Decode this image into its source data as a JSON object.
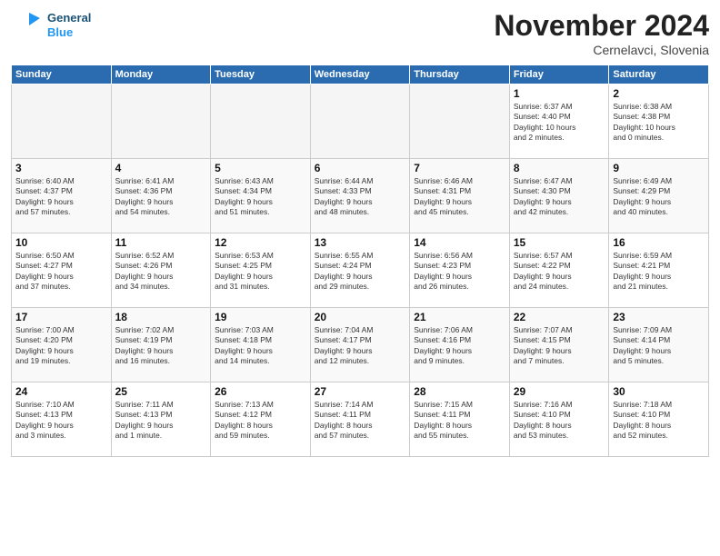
{
  "logo": {
    "line1": "General",
    "line2": "Blue"
  },
  "title": "November 2024",
  "location": "Cernelavci, Slovenia",
  "weekdays": [
    "Sunday",
    "Monday",
    "Tuesday",
    "Wednesday",
    "Thursday",
    "Friday",
    "Saturday"
  ],
  "weeks": [
    [
      {
        "day": "",
        "info": ""
      },
      {
        "day": "",
        "info": ""
      },
      {
        "day": "",
        "info": ""
      },
      {
        "day": "",
        "info": ""
      },
      {
        "day": "",
        "info": ""
      },
      {
        "day": "1",
        "info": "Sunrise: 6:37 AM\nSunset: 4:40 PM\nDaylight: 10 hours\nand 2 minutes."
      },
      {
        "day": "2",
        "info": "Sunrise: 6:38 AM\nSunset: 4:38 PM\nDaylight: 10 hours\nand 0 minutes."
      }
    ],
    [
      {
        "day": "3",
        "info": "Sunrise: 6:40 AM\nSunset: 4:37 PM\nDaylight: 9 hours\nand 57 minutes."
      },
      {
        "day": "4",
        "info": "Sunrise: 6:41 AM\nSunset: 4:36 PM\nDaylight: 9 hours\nand 54 minutes."
      },
      {
        "day": "5",
        "info": "Sunrise: 6:43 AM\nSunset: 4:34 PM\nDaylight: 9 hours\nand 51 minutes."
      },
      {
        "day": "6",
        "info": "Sunrise: 6:44 AM\nSunset: 4:33 PM\nDaylight: 9 hours\nand 48 minutes."
      },
      {
        "day": "7",
        "info": "Sunrise: 6:46 AM\nSunset: 4:31 PM\nDaylight: 9 hours\nand 45 minutes."
      },
      {
        "day": "8",
        "info": "Sunrise: 6:47 AM\nSunset: 4:30 PM\nDaylight: 9 hours\nand 42 minutes."
      },
      {
        "day": "9",
        "info": "Sunrise: 6:49 AM\nSunset: 4:29 PM\nDaylight: 9 hours\nand 40 minutes."
      }
    ],
    [
      {
        "day": "10",
        "info": "Sunrise: 6:50 AM\nSunset: 4:27 PM\nDaylight: 9 hours\nand 37 minutes."
      },
      {
        "day": "11",
        "info": "Sunrise: 6:52 AM\nSunset: 4:26 PM\nDaylight: 9 hours\nand 34 minutes."
      },
      {
        "day": "12",
        "info": "Sunrise: 6:53 AM\nSunset: 4:25 PM\nDaylight: 9 hours\nand 31 minutes."
      },
      {
        "day": "13",
        "info": "Sunrise: 6:55 AM\nSunset: 4:24 PM\nDaylight: 9 hours\nand 29 minutes."
      },
      {
        "day": "14",
        "info": "Sunrise: 6:56 AM\nSunset: 4:23 PM\nDaylight: 9 hours\nand 26 minutes."
      },
      {
        "day": "15",
        "info": "Sunrise: 6:57 AM\nSunset: 4:22 PM\nDaylight: 9 hours\nand 24 minutes."
      },
      {
        "day": "16",
        "info": "Sunrise: 6:59 AM\nSunset: 4:21 PM\nDaylight: 9 hours\nand 21 minutes."
      }
    ],
    [
      {
        "day": "17",
        "info": "Sunrise: 7:00 AM\nSunset: 4:20 PM\nDaylight: 9 hours\nand 19 minutes."
      },
      {
        "day": "18",
        "info": "Sunrise: 7:02 AM\nSunset: 4:19 PM\nDaylight: 9 hours\nand 16 minutes."
      },
      {
        "day": "19",
        "info": "Sunrise: 7:03 AM\nSunset: 4:18 PM\nDaylight: 9 hours\nand 14 minutes."
      },
      {
        "day": "20",
        "info": "Sunrise: 7:04 AM\nSunset: 4:17 PM\nDaylight: 9 hours\nand 12 minutes."
      },
      {
        "day": "21",
        "info": "Sunrise: 7:06 AM\nSunset: 4:16 PM\nDaylight: 9 hours\nand 9 minutes."
      },
      {
        "day": "22",
        "info": "Sunrise: 7:07 AM\nSunset: 4:15 PM\nDaylight: 9 hours\nand 7 minutes."
      },
      {
        "day": "23",
        "info": "Sunrise: 7:09 AM\nSunset: 4:14 PM\nDaylight: 9 hours\nand 5 minutes."
      }
    ],
    [
      {
        "day": "24",
        "info": "Sunrise: 7:10 AM\nSunset: 4:13 PM\nDaylight: 9 hours\nand 3 minutes."
      },
      {
        "day": "25",
        "info": "Sunrise: 7:11 AM\nSunset: 4:13 PM\nDaylight: 9 hours\nand 1 minute."
      },
      {
        "day": "26",
        "info": "Sunrise: 7:13 AM\nSunset: 4:12 PM\nDaylight: 8 hours\nand 59 minutes."
      },
      {
        "day": "27",
        "info": "Sunrise: 7:14 AM\nSunset: 4:11 PM\nDaylight: 8 hours\nand 57 minutes."
      },
      {
        "day": "28",
        "info": "Sunrise: 7:15 AM\nSunset: 4:11 PM\nDaylight: 8 hours\nand 55 minutes."
      },
      {
        "day": "29",
        "info": "Sunrise: 7:16 AM\nSunset: 4:10 PM\nDaylight: 8 hours\nand 53 minutes."
      },
      {
        "day": "30",
        "info": "Sunrise: 7:18 AM\nSunset: 4:10 PM\nDaylight: 8 hours\nand 52 minutes."
      }
    ]
  ]
}
